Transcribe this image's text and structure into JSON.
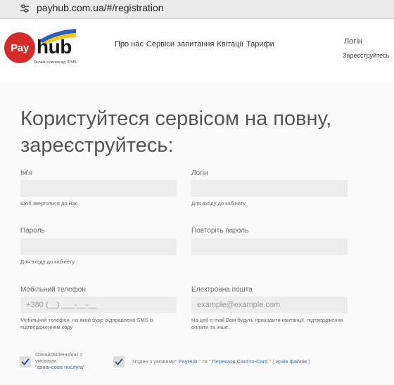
{
  "browser": {
    "url": "payhub.com.ua/#/registration"
  },
  "logo": {
    "pay": "Pay",
    "hub": "hub",
    "tagline": "Онлайн платежі від ПУМБ"
  },
  "nav": [
    "Про нас",
    "Сервіси",
    "запитання",
    "Квітації",
    "Тарифи"
  ],
  "header": {
    "login": "Логін",
    "register": "Зареєструйтесь"
  },
  "title": "Користуйтеся сервісом на повну, зареєструйтесь:",
  "form": {
    "name": {
      "label": "Ім'я",
      "value": "",
      "hint": "Щоб звертатися до Вас"
    },
    "login": {
      "label": "Логін",
      "value": "",
      "hint": "Для входу до кабінету"
    },
    "password": {
      "label": "Пароль",
      "value": "",
      "hint": "Для входу до кабінету"
    },
    "password_repeat": {
      "label": "Повторіть пароль",
      "value": ""
    },
    "phone": {
      "label": "Мобільний телефон",
      "placeholder": "+380 (__) ___-__-__",
      "hint": "Мобільний телефон, на який буде відправлено SMS із підтвердженням коду"
    },
    "email": {
      "label": "Електронна пошта",
      "placeholder": "example@example.com",
      "hint": "На цей e-mail Вам будуть приходити квитанції, підтвердження оплати та інше."
    }
  },
  "agreements": {
    "first": {
      "line1": "Ознайомлений(а) з",
      "line2": "умовами",
      "quote_open": "\"",
      "link": "фінансова послуга",
      "quote_close": "\""
    },
    "second": {
      "prefix": "Згоден з умовами\"",
      "link1": "PayHub",
      "mid1": "\" та \"",
      "link2": "Перекази Card-to-Card",
      "mid2": "\" (",
      "link3": "архів файлів",
      "suffix": ")"
    }
  },
  "colors": {
    "accent": "#3b6fb6",
    "logo_red": "#d52b2b",
    "field_bg": "#ededed"
  }
}
